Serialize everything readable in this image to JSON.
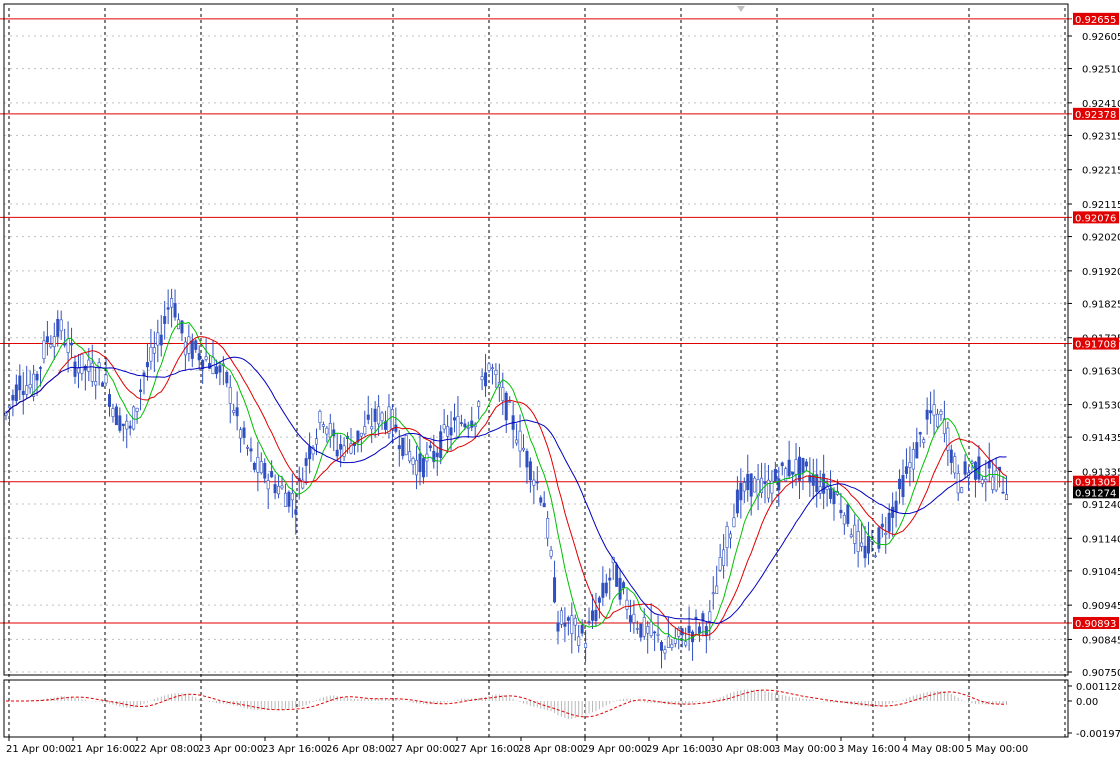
{
  "colors": {
    "background": "#ffffff",
    "grid": "#c0c0c0",
    "candle": "#3050c0",
    "ma_fast": "#00c000",
    "ma_mid": "#e00000",
    "ma_slow": "#0000c0",
    "hline": "#e00000",
    "label_bg": "#e00000",
    "label_text": "#ffffff",
    "current_bg": "#000000",
    "axis_text": "#000000",
    "osc_bar": "#b8b8b8",
    "osc_signal": "#e00000"
  },
  "price_axis": {
    "ticks": [
      "0.92605",
      "0.92510",
      "0.92410",
      "0.92315",
      "0.92215",
      "0.92115",
      "0.92020",
      "0.91920",
      "0.91825",
      "0.91725",
      "0.91630",
      "0.91530",
      "0.91435",
      "0.91335",
      "0.91240",
      "0.91140",
      "0.91045",
      "0.90945",
      "0.90845",
      "0.90750"
    ]
  },
  "levels": [
    {
      "value": 0.92655,
      "label": "0.92655"
    },
    {
      "value": 0.92378,
      "label": "0.92378"
    },
    {
      "value": 0.92076,
      "label": "0.92076"
    },
    {
      "value": 0.91708,
      "label": "0.91708"
    },
    {
      "value": 0.91305,
      "label": "0.91305"
    },
    {
      "value": 0.90893,
      "label": "0.90893"
    }
  ],
  "current_price": {
    "value": 0.91274,
    "label": "0.91274"
  },
  "time_axis": {
    "labels": [
      "21 Apr 00:00",
      "21 Apr 16:00",
      "22 Apr 08:00",
      "23 Apr 00:00",
      "23 Apr 16:00",
      "26 Apr 08:00",
      "27 Apr 00:00",
      "27 Apr 16:00",
      "28 Apr 08:00",
      "29 Apr 00:00",
      "29 Apr 16:00",
      "30 Apr 08:00",
      "3 May 00:00",
      "3 May 16:00",
      "4 May 08:00",
      "5 May 00:00"
    ]
  },
  "oscillator": {
    "ticks": [
      "0.001128",
      "0.00",
      "-0.001974"
    ]
  },
  "chart_data": {
    "type": "candlestick",
    "series_anchors": [
      [
        0,
        0.915
      ],
      [
        4,
        0.916
      ],
      [
        8,
        0.9158
      ],
      [
        12,
        0.9172
      ],
      [
        16,
        0.9175
      ],
      [
        20,
        0.9165
      ],
      [
        24,
        0.9163
      ],
      [
        28,
        0.9162
      ],
      [
        32,
        0.915
      ],
      [
        36,
        0.9145
      ],
      [
        40,
        0.9162
      ],
      [
        44,
        0.917
      ],
      [
        48,
        0.9185
      ],
      [
        52,
        0.917
      ],
      [
        56,
        0.9168
      ],
      [
        60,
        0.9165
      ],
      [
        64,
        0.916
      ],
      [
        68,
        0.9145
      ],
      [
        72,
        0.9135
      ],
      [
        76,
        0.9132
      ],
      [
        80,
        0.9128
      ],
      [
        84,
        0.9125
      ],
      [
        88,
        0.914
      ],
      [
        92,
        0.915
      ],
      [
        96,
        0.914
      ],
      [
        100,
        0.9142
      ],
      [
        104,
        0.9145
      ],
      [
        108,
        0.915
      ],
      [
        112,
        0.9148
      ],
      [
        116,
        0.914
      ],
      [
        120,
        0.9135
      ],
      [
        124,
        0.9138
      ],
      [
        128,
        0.9145
      ],
      [
        132,
        0.9148
      ],
      [
        136,
        0.915
      ],
      [
        140,
        0.9165
      ],
      [
        144,
        0.9155
      ],
      [
        148,
        0.9145
      ],
      [
        152,
        0.9135
      ],
      [
        156,
        0.9125
      ],
      [
        160,
        0.909
      ],
      [
        164,
        0.9088
      ],
      [
        168,
        0.9085
      ],
      [
        172,
        0.9095
      ],
      [
        176,
        0.9105
      ],
      [
        180,
        0.9095
      ],
      [
        184,
        0.9088
      ],
      [
        188,
        0.9085
      ],
      [
        192,
        0.9082
      ],
      [
        196,
        0.9085
      ],
      [
        200,
        0.9088
      ],
      [
        204,
        0.909
      ],
      [
        208,
        0.911
      ],
      [
        212,
        0.9125
      ],
      [
        216,
        0.913
      ],
      [
        220,
        0.9128
      ],
      [
        224,
        0.9132
      ],
      [
        228,
        0.9135
      ],
      [
        232,
        0.9133
      ],
      [
        236,
        0.913
      ],
      [
        240,
        0.9128
      ],
      [
        244,
        0.912
      ],
      [
        248,
        0.911
      ],
      [
        252,
        0.9112
      ],
      [
        256,
        0.912
      ],
      [
        260,
        0.913
      ],
      [
        264,
        0.914
      ],
      [
        268,
        0.915
      ],
      [
        272,
        0.9148
      ],
      [
        276,
        0.913
      ],
      [
        280,
        0.9135
      ],
      [
        284,
        0.9133
      ],
      [
        288,
        0.9131
      ],
      [
        290,
        0.9129
      ]
    ]
  }
}
